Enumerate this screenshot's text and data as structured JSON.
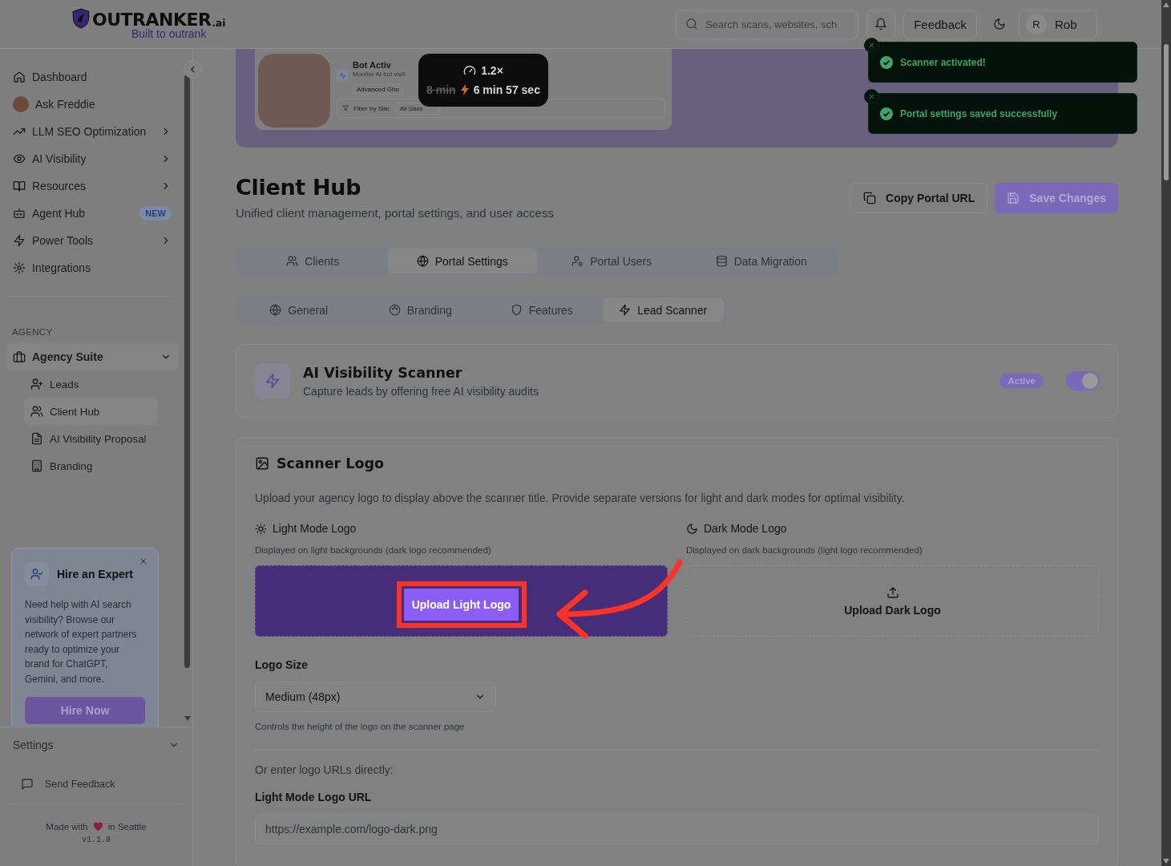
{
  "header": {
    "logo": {
      "wordmark": "OUTRANKER",
      "suffix": ".ai",
      "tagline": "Built to outrank"
    },
    "search": {
      "placeholder": "Search scans, websites, sch"
    },
    "feedback_button": "Feedback",
    "user": {
      "initial": "R",
      "name": "Rob"
    }
  },
  "toasts": [
    {
      "message": "Scanner activated!"
    },
    {
      "message": "Portal settings saved successfully"
    }
  ],
  "sidebar": {
    "items": [
      {
        "label": "Dashboard",
        "has_submenu": false
      },
      {
        "label": "Ask Freddie",
        "has_submenu": false
      },
      {
        "label": "LLM SEO Optimization",
        "has_submenu": true
      },
      {
        "label": "AI Visibility",
        "has_submenu": true
      },
      {
        "label": "Resources",
        "has_submenu": true
      },
      {
        "label": "Agent Hub",
        "has_submenu": false,
        "badge": "NEW"
      },
      {
        "label": "Power Tools",
        "has_submenu": true
      },
      {
        "label": "Integrations",
        "has_submenu": false
      }
    ],
    "section_label": "AGENCY",
    "group": {
      "label": "Agency Suite",
      "expanded": true,
      "children": [
        {
          "label": "Leads",
          "selected": false
        },
        {
          "label": "Client Hub",
          "selected": true
        },
        {
          "label": "AI Visibility Proposal",
          "selected": false
        },
        {
          "label": "Branding",
          "selected": false
        }
      ]
    },
    "promo": {
      "title": "Hire an Expert",
      "body": "Need help with AI search visibility? Browse our network of expert partners ready to optimize your brand for ChatGPT, Gemini, and more.",
      "button": "Hire Now"
    },
    "settings": {
      "label": "Settings",
      "expanded": false
    },
    "send_feedback": "Send Feedback",
    "footer": {
      "made_with": "Made with",
      "location": "in Seattle",
      "version": "v1.1.0"
    }
  },
  "video_overlay": {
    "card_title": "Bot Activ",
    "card_subtitle": "Monitor AI bot visit",
    "chip": "Advanced Gho",
    "filter_label": "Filter by Site:",
    "filter_value": "All Sites",
    "speed": "1.2×",
    "original_time": "8 min",
    "new_time": "6 min 57 sec"
  },
  "page": {
    "title": "Client Hub",
    "subtitle": "Unified client management, portal settings, and user access",
    "actions": [
      {
        "label": "Copy Portal URL",
        "kind": "secondary"
      },
      {
        "label": "Save Changes",
        "kind": "primary"
      }
    ],
    "tabs": [
      {
        "label": "Clients",
        "selected": false
      },
      {
        "label": "Portal Settings",
        "selected": true
      },
      {
        "label": "Portal Users",
        "selected": false
      },
      {
        "label": "Data Migration",
        "selected": false
      }
    ],
    "subtabs": [
      {
        "label": "General",
        "selected": false
      },
      {
        "label": "Branding",
        "selected": false
      },
      {
        "label": "Features",
        "selected": false
      },
      {
        "label": "Lead Scanner",
        "selected": true
      }
    ],
    "scanner_card": {
      "title": "AI Visibility Scanner",
      "description": "Capture leads by offering free AI visibility audits",
      "status": "Active",
      "enabled": true
    },
    "logo_section": {
      "title": "Scanner Logo",
      "description": "Upload your agency logo to display above the scanner title. Provide separate versions for light and dark modes for optimal visibility.",
      "modes": [
        {
          "label": "Light Mode Logo",
          "hint": "Displayed on light backgrounds (dark logo recommended)",
          "upload": "Upload Light Logo",
          "highlighted": true
        },
        {
          "label": "Dark Mode Logo",
          "hint": "Displayed on dark backgrounds (light logo recommended)",
          "upload": "Upload Dark Logo",
          "highlighted": false
        }
      ],
      "size": {
        "label": "Logo Size",
        "value": "Medium (48px)",
        "hint": "Controls the height of the logo on the scanner page"
      },
      "urls_intro": "Or enter logo URLs directly:",
      "url_fields": [
        {
          "label": "Light Mode Logo URL",
          "placeholder": "https://example.com/logo-dark.png"
        }
      ]
    }
  }
}
